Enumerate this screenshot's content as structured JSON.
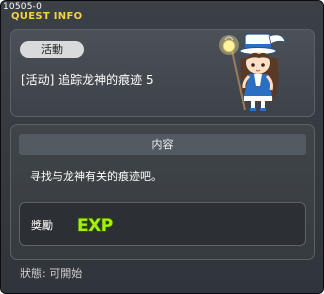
{
  "window": {
    "id_label": "10505-0",
    "title": "QUEST INFO"
  },
  "quest": {
    "category": "活動",
    "title": "[活动] 追踪龙神的痕迹 5"
  },
  "content": {
    "header": "内容",
    "description": "寻找与龙神有关的痕迹吧。"
  },
  "reward": {
    "label": "獎勵",
    "icon_name": "exp-icon",
    "icon_text": "EXP"
  },
  "status": {
    "text": "狀態: 可開始"
  },
  "npc": {
    "icon_name": "npc-portrait"
  },
  "colors": {
    "title_yellow": "#f0d245",
    "window_bg": "#353a40",
    "exp_green": "#9ee800"
  }
}
